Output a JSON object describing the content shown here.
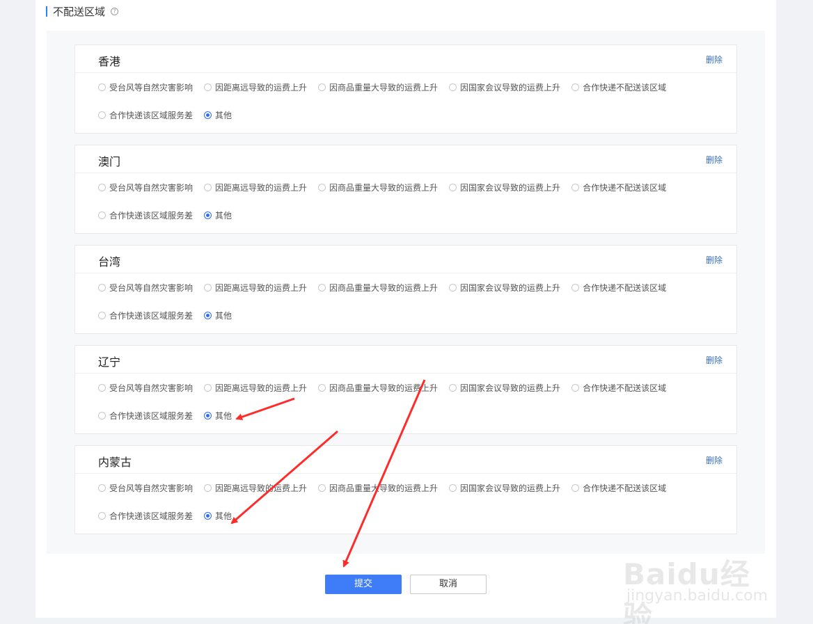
{
  "section": {
    "title": "不配送区域",
    "help_icon": "?"
  },
  "regions": [
    {
      "name": "香港",
      "delete_label": "删除"
    },
    {
      "name": "澳门",
      "delete_label": "删除"
    },
    {
      "name": "台湾",
      "delete_label": "删除"
    },
    {
      "name": "辽宁",
      "delete_label": "删除"
    },
    {
      "name": "内蒙古",
      "delete_label": "删除"
    }
  ],
  "reasons": [
    "受台风等自然灾害影响",
    "因距离远导致的运费上升",
    "因商品重量大导致的运费上升",
    "因国家会议导致的运费上升",
    "合作快递不配送该区域",
    "合作快递该区域服务差",
    "其他"
  ],
  "selected_reason": "其他",
  "buttons": {
    "submit": "提交",
    "cancel": "取消"
  },
  "watermark": {
    "main": "Baidu经验",
    "sub": "jingyan.baidu.com"
  },
  "colors": {
    "accent": "#3f7cf7",
    "arrow": "#ff2a2a",
    "delete_link": "#3a6ec9"
  }
}
